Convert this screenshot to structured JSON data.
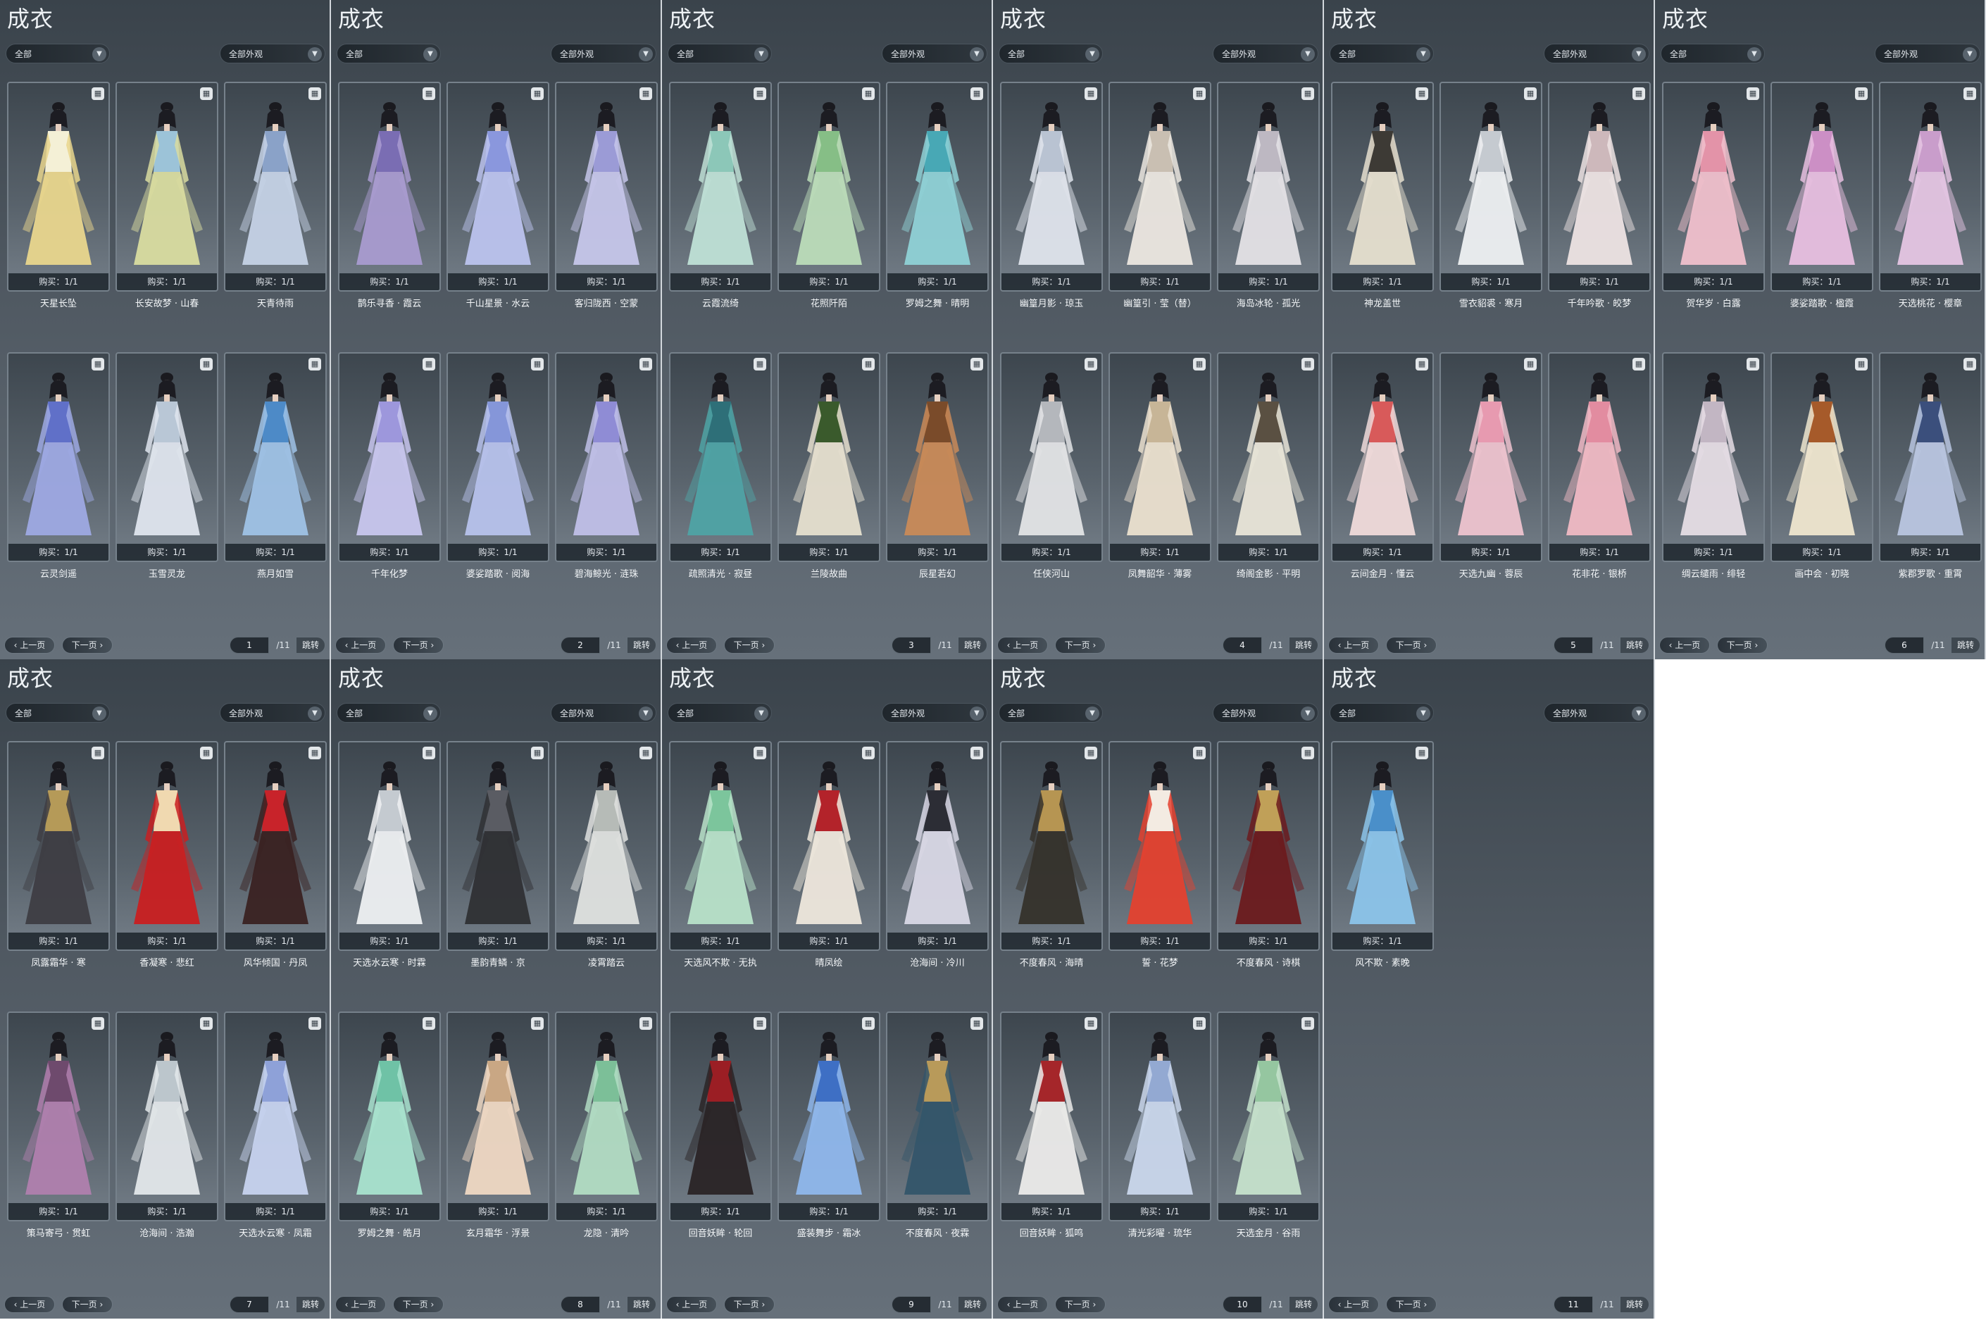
{
  "pages": [
    {
      "title": "成衣",
      "filter_category": "全部",
      "filter_appearance": "全部外观",
      "prev_label": "上一页",
      "next_label": "下一页",
      "current_page": "1",
      "total_pages": "/11",
      "jump_label": "跳转",
      "items": [
        {
          "name": "天星长坠",
          "buy": "购买：1/1",
          "dress_color": "#e9d68d",
          "accent_color": "#f4f0d6"
        },
        {
          "name": "长安故梦 · 山春",
          "buy": "购买：1/1",
          "dress_color": "#d9dca0",
          "accent_color": "#9cc3d8"
        },
        {
          "name": "天青待雨",
          "buy": "购买：1/1",
          "dress_color": "#c5d2e6",
          "accent_color": "#8aa2c8"
        },
        {
          "name": "云灵剑遥",
          "buy": "购买：1/1",
          "dress_color": "#9ea9e3",
          "accent_color": "#6070c8"
        },
        {
          "name": "玉雪灵龙",
          "buy": "购买：1/1",
          "dress_color": "#dfe5ee",
          "accent_color": "#b9c7d6"
        },
        {
          "name": "燕月如雪",
          "buy": "购买：1/1",
          "dress_color": "#9fc2e6",
          "accent_color": "#4d8ac7"
        }
      ]
    },
    {
      "title": "成衣",
      "filter_category": "全部",
      "filter_appearance": "全部外观",
      "prev_label": "上一页",
      "next_label": "下一页",
      "current_page": "2",
      "total_pages": "/11",
      "jump_label": "跳转",
      "items": [
        {
          "name": "鹊乐寻香 · 霞云",
          "buy": "购买：1/1",
          "dress_color": "#a99bd0",
          "accent_color": "#7a6db3"
        },
        {
          "name": "千山星景 · 水云",
          "buy": "购买：1/1",
          "dress_color": "#bcc3ee",
          "accent_color": "#8a97dd"
        },
        {
          "name": "客归陇西 · 空蒙",
          "buy": "购买：1/1",
          "dress_color": "#c6c6ea",
          "accent_color": "#9b9bd6"
        },
        {
          "name": "千年化梦",
          "buy": "购买：1/1",
          "dress_color": "#c8c6ee",
          "accent_color": "#9d97dc"
        },
        {
          "name": "婆娑踏歌 · 阅海",
          "buy": "购买：1/1",
          "dress_color": "#b7c2ec",
          "accent_color": "#8596d9"
        },
        {
          "name": "碧海鲸光 · 涟珠",
          "buy": "购买：1/1",
          "dress_color": "#c0bfe8",
          "accent_color": "#8f8cd5"
        }
      ]
    },
    {
      "title": "成衣",
      "filter_category": "全部",
      "filter_appearance": "全部外观",
      "prev_label": "上一页",
      "next_label": "下一页",
      "current_page": "3",
      "total_pages": "/11",
      "jump_label": "跳转",
      "items": [
        {
          "name": "云霞流绮",
          "buy": "购买：1/1",
          "dress_color": "#bfe0d6",
          "accent_color": "#8cc7b8"
        },
        {
          "name": "花照阡陌",
          "buy": "购买：1/1",
          "dress_color": "#bcdcb9",
          "accent_color": "#86be86"
        },
        {
          "name": "罗姆之舞 · 晴明",
          "buy": "购买：1/1",
          "dress_color": "#8fd1d6",
          "accent_color": "#48a8b5"
        },
        {
          "name": "疏照清光 · 寂昼",
          "buy": "购买：1/1",
          "dress_color": "#4fa3a5",
          "accent_color": "#2e6f78"
        },
        {
          "name": "兰陵故曲",
          "buy": "购买：1/1",
          "dress_color": "#e6dfcf",
          "accent_color": "#3a5a2c"
        },
        {
          "name": "辰星若幻",
          "buy": "购买：1/1",
          "dress_color": "#c98a58",
          "accent_color": "#7a4b2a"
        }
      ]
    },
    {
      "title": "成衣",
      "filter_category": "全部",
      "filter_appearance": "全部外观",
      "prev_label": "上一页",
      "next_label": "下一页",
      "current_page": "4",
      "total_pages": "/11",
      "jump_label": "跳转",
      "items": [
        {
          "name": "幽篁月影 · 琼玉",
          "buy": "购买：1/1",
          "dress_color": "#dfe4ec",
          "accent_color": "#b9c3d2"
        },
        {
          "name": "幽篁引 · 莹（替）",
          "buy": "购买：1/1",
          "dress_color": "#ece7e0",
          "accent_color": "#c9bfb2"
        },
        {
          "name": "海岛冰轮 · 孤光",
          "buy": "购买：1/1",
          "dress_color": "#e4e2e6",
          "accent_color": "#bdb8c2"
        },
        {
          "name": "任侠河山",
          "buy": "购买：1/1",
          "dress_color": "#e3e4e6",
          "accent_color": "#b4b7bc"
        },
        {
          "name": "凤舞韶华 · 薄雾",
          "buy": "购买：1/1",
          "dress_color": "#ebe0cf",
          "accent_color": "#c7b597"
        },
        {
          "name": "绮阁金影 · 平明",
          "buy": "购买：1/1",
          "dress_color": "#e9e5d8",
          "accent_color": "#5a5042"
        }
      ]
    },
    {
      "title": "成衣",
      "filter_category": "全部",
      "filter_appearance": "全部外观",
      "prev_label": "上一页",
      "next_label": "下一页",
      "current_page": "5",
      "total_pages": "/11",
      "jump_label": "跳转",
      "items": [
        {
          "name": "神龙盖世",
          "buy": "购买：1/1",
          "dress_color": "#e6dfcf",
          "accent_color": "#3d3a35"
        },
        {
          "name": "雪衣貂裘 · 寒月",
          "buy": "购买：1/1",
          "dress_color": "#eef0f2",
          "accent_color": "#c5cad0"
        },
        {
          "name": "千年吟歌 · 皎梦",
          "buy": "购买：1/1",
          "dress_color": "#ede3e3",
          "accent_color": "#cdb8bb"
        },
        {
          "name": "云间金月 · 懂云",
          "buy": "购买：1/1",
          "dress_color": "#f0dada",
          "accent_color": "#d85a5a"
        },
        {
          "name": "天选九幽 · 蓉辰",
          "buy": "购买：1/1",
          "dress_color": "#eec3cf",
          "accent_color": "#e79ab0"
        },
        {
          "name": "花非花 · 银桥",
          "buy": "购买：1/1",
          "dress_color": "#f0b9c4",
          "accent_color": "#e28ca0"
        }
      ]
    },
    {
      "title": "成衣",
      "filter_category": "全部",
      "filter_appearance": "全部外观",
      "prev_label": "上一页",
      "next_label": "下一页",
      "current_page": "6",
      "total_pages": "/11",
      "jump_label": "跳转",
      "items": [
        {
          "name": "贺华岁 · 白露",
          "buy": "购买：1/1",
          "dress_color": "#f0c0cc",
          "accent_color": "#e393a8"
        },
        {
          "name": "婆娑踏歌 · 楹霞",
          "buy": "购买：1/1",
          "dress_color": "#e8bfe0",
          "accent_color": "#cc8fc5"
        },
        {
          "name": "天选桃花 · 樱章",
          "buy": "购买：1/1",
          "dress_color": "#e5c5e3",
          "accent_color": "#c99dcb"
        },
        {
          "name": "绸云缱雨 · 绯轻",
          "buy": "购买：1/1",
          "dress_color": "#e6dde5",
          "accent_color": "#c2b6c3"
        },
        {
          "name": "画中会 · 初晓",
          "buy": "购买：1/1",
          "dress_color": "#efe6cf",
          "accent_color": "#a65a2a"
        },
        {
          "name": "紫郡罗歌 · 重霄",
          "buy": "购买：1/1",
          "dress_color": "#b9c5e0",
          "accent_color": "#3b4f7c"
        }
      ]
    },
    {
      "title": "成衣",
      "filter_category": "全部",
      "filter_appearance": "全部外观",
      "prev_label": "上一页",
      "next_label": "下一页",
      "current_page": "7",
      "total_pages": "/11",
      "jump_label": "跳转",
      "items": [
        {
          "name": "凤露霜华 · 寒",
          "buy": "购买：1/1",
          "dress_color": "#3e3d43",
          "accent_color": "#b59a58"
        },
        {
          "name": "香凝寒 · 悲红",
          "buy": "购买：1/1",
          "dress_color": "#c91f21",
          "accent_color": "#f0d9b0"
        },
        {
          "name": "风华倾国 · 丹凤",
          "buy": "购买：1/1",
          "dress_color": "#3a2222",
          "accent_color": "#c8232a"
        },
        {
          "name": "策马寄弓 · 贯虹",
          "buy": "购买：1/1",
          "dress_color": "#b07fae",
          "accent_color": "#6e4a6d"
        },
        {
          "name": "沧海间 · 浩瀚",
          "buy": "购买：1/1",
          "dress_color": "#e3e7ea",
          "accent_color": "#bcc6cc"
        },
        {
          "name": "天选水云寒 · 凤霜",
          "buy": "购买：1/1",
          "dress_color": "#c7d3ef",
          "accent_color": "#8ea1d8"
        }
      ]
    },
    {
      "title": "成衣",
      "filter_category": "全部",
      "filter_appearance": "全部外观",
      "prev_label": "上一页",
      "next_label": "下一页",
      "current_page": "8",
      "total_pages": "/11",
      "jump_label": "跳转",
      "items": [
        {
          "name": "天选水云寒 · 时霖",
          "buy": "购买：1/1",
          "dress_color": "#eef0f2",
          "accent_color": "#c4cad0"
        },
        {
          "name": "墨韵青鳞 · 京",
          "buy": "购买：1/1",
          "dress_color": "#2f3034",
          "accent_color": "#5a5c63"
        },
        {
          "name": "凌霄踏云",
          "buy": "购买：1/1",
          "dress_color": "#dfe1df",
          "accent_color": "#b6bbb7"
        },
        {
          "name": "罗姆之舞 · 皓月",
          "buy": "购买：1/1",
          "dress_color": "#a9e3cf",
          "accent_color": "#6fc2a6"
        },
        {
          "name": "玄月霜华 · 浮景",
          "buy": "购买：1/1",
          "dress_color": "#efd8c3",
          "accent_color": "#c9a784"
        },
        {
          "name": "龙隐 · 清吟",
          "buy": "购买：1/1",
          "dress_color": "#b2dcc3",
          "accent_color": "#7cbf98"
        }
      ]
    },
    {
      "title": "成衣",
      "filter_category": "全部",
      "filter_appearance": "全部外观",
      "prev_label": "上一页",
      "next_label": "下一页",
      "current_page": "9",
      "total_pages": "/11",
      "jump_label": "跳转",
      "items": [
        {
          "name": "天选风不欺 · 无执",
          "buy": "购买：1/1",
          "dress_color": "#b8e2c9",
          "accent_color": "#7cc59c"
        },
        {
          "name": "晴凤绘",
          "buy": "购买：1/1",
          "dress_color": "#eee7dc",
          "accent_color": "#b3232a"
        },
        {
          "name": "沧海间 · 冷川",
          "buy": "购买：1/1",
          "dress_color": "#d9d8e6",
          "accent_color": "#2c2d35"
        },
        {
          "name": "回音妖眸 · 轮回",
          "buy": "购买：1/1",
          "dress_color": "#2a2426",
          "accent_color": "#9b1e24"
        },
        {
          "name": "盛装舞步 · 霜冰",
          "buy": "购买：1/1",
          "dress_color": "#8fb7ec",
          "accent_color": "#3e6fc4"
        },
        {
          "name": "不度春风 · 夜霖",
          "buy": "购买：1/1",
          "dress_color": "#34556a",
          "accent_color": "#b89a5a"
        }
      ]
    },
    {
      "title": "成衣",
      "filter_category": "全部",
      "filter_appearance": "全部外观",
      "prev_label": "上一页",
      "next_label": "下一页",
      "current_page": "10",
      "total_pages": "/11",
      "jump_label": "跳转",
      "items": [
        {
          "name": "不度春风 · 海晴",
          "buy": "购买：1/1",
          "dress_color": "#35312b",
          "accent_color": "#b69552"
        },
        {
          "name": "誓 · 花梦",
          "buy": "购买：1/1",
          "dress_color": "#e4412f",
          "accent_color": "#f3ebe2"
        },
        {
          "name": "不度春风 · 诗棋",
          "buy": "购买：1/1",
          "dress_color": "#6b1a1d",
          "accent_color": "#c0a058"
        },
        {
          "name": "回音妖眸 · 狐鸣",
          "buy": "购买：1/1",
          "dress_color": "#ecebea",
          "accent_color": "#a5262a"
        },
        {
          "name": "清光彩曜 · 琉华",
          "buy": "购买：1/1",
          "dress_color": "#cad7ec",
          "accent_color": "#93a9d2"
        },
        {
          "name": "天选金月 · 谷雨",
          "buy": "购买：1/1",
          "dress_color": "#c6e2cc",
          "accent_color": "#95c6a0"
        }
      ]
    },
    {
      "title": "成衣",
      "filter_category": "全部",
      "filter_appearance": "全部外观",
      "prev_label": "上一页",
      "next_label": "下一页",
      "current_page": "11",
      "total_pages": "/11",
      "jump_label": "跳转",
      "items": [
        {
          "name": "风不欺 · 素晚",
          "buy": "购买：1/1",
          "dress_color": "#8cc4ea",
          "accent_color": "#4a8fc9"
        }
      ]
    }
  ]
}
